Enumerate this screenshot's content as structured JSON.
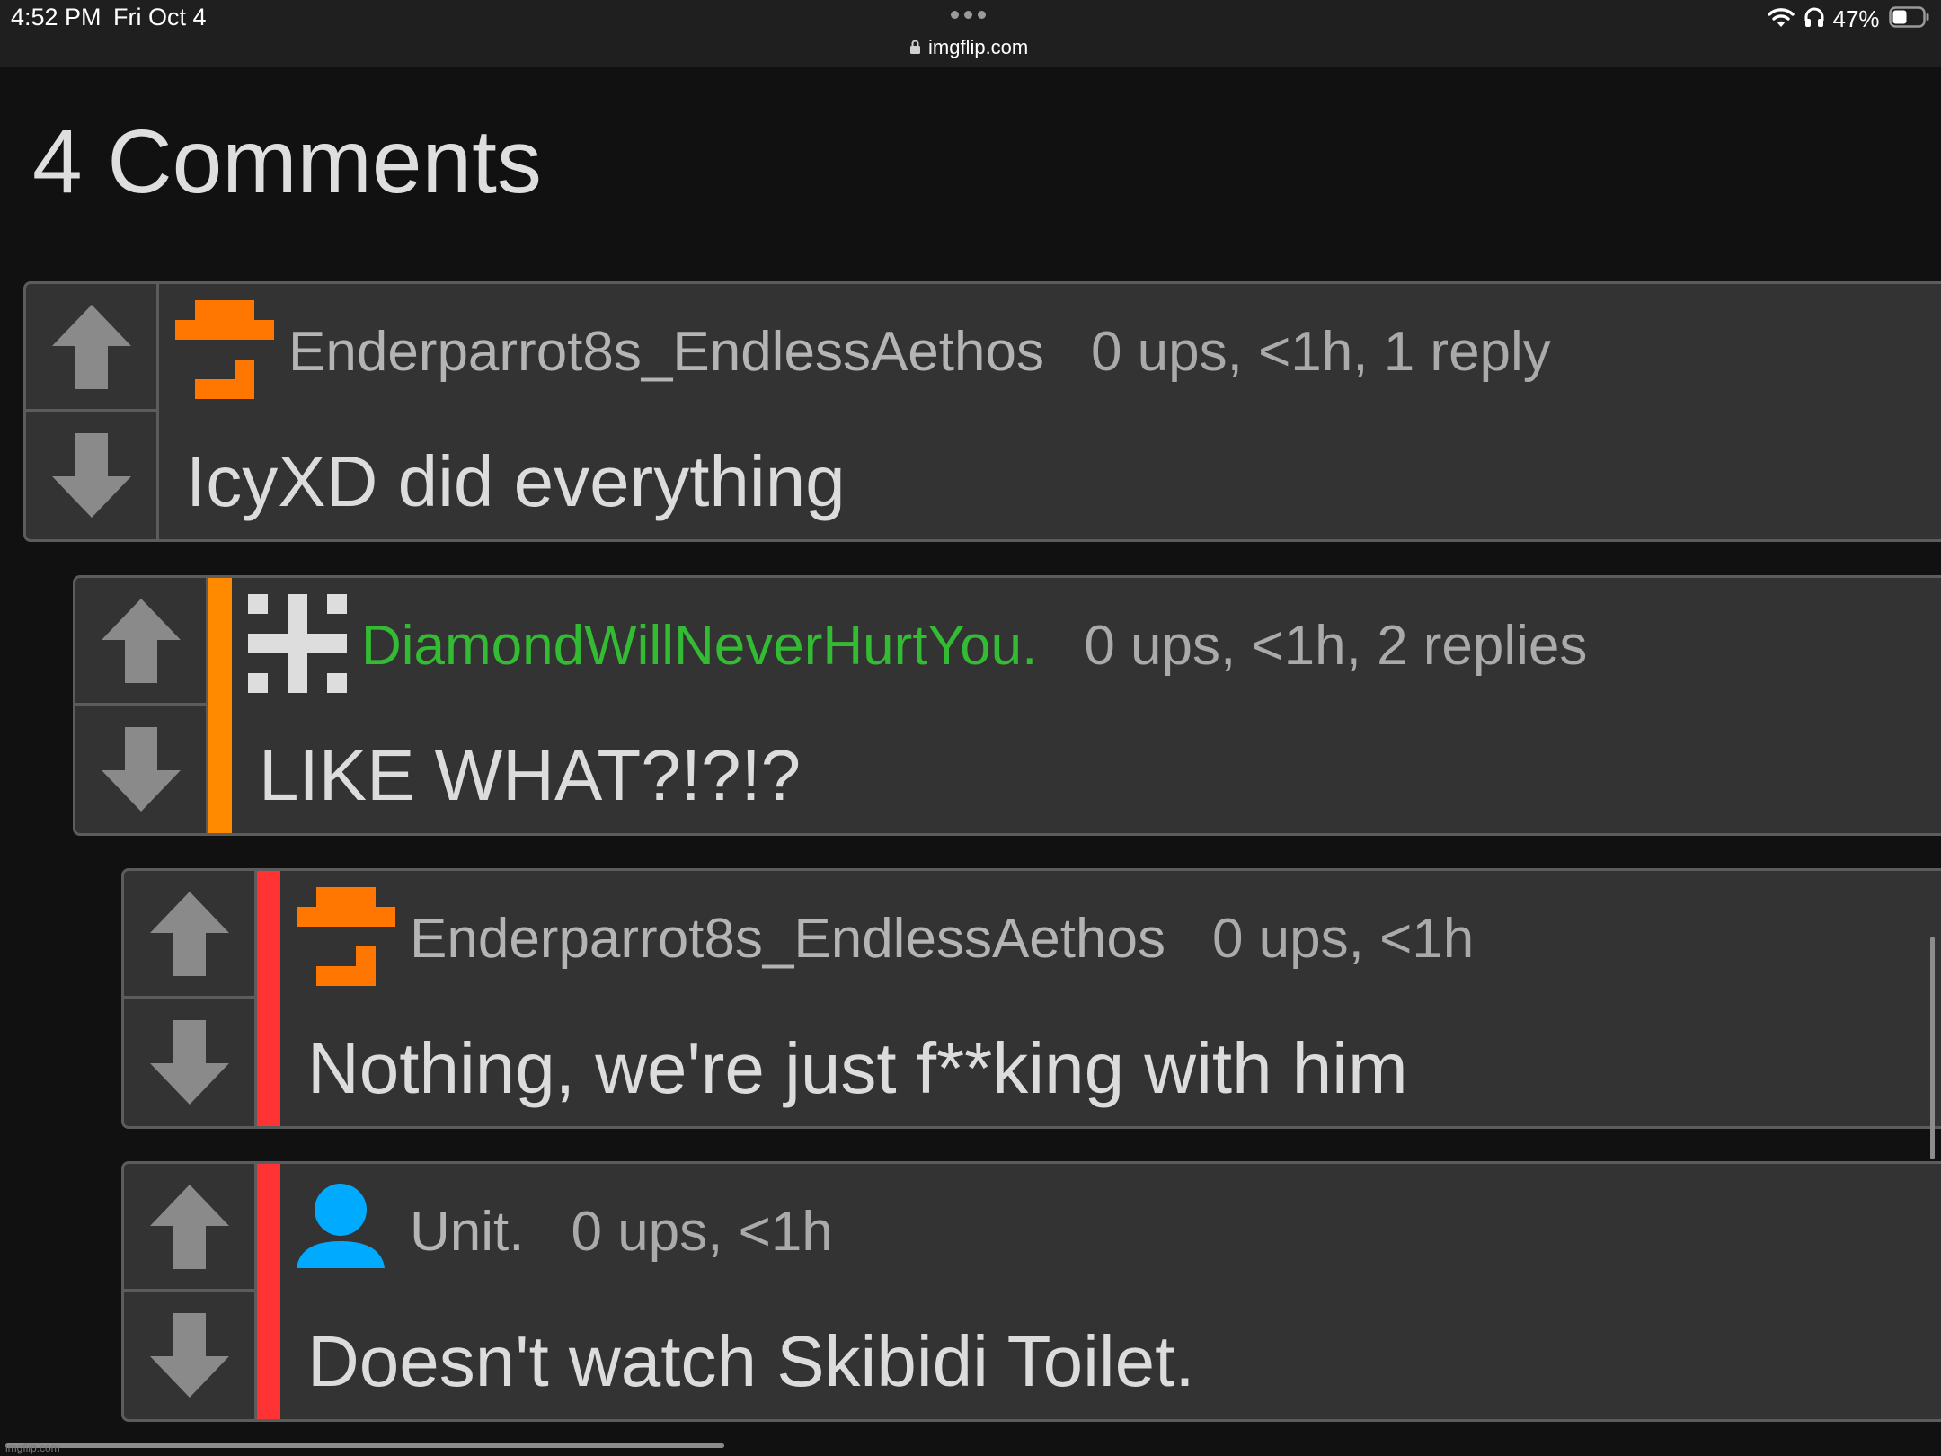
{
  "status_bar": {
    "time": "4:52 PM",
    "date": "Fri Oct 4",
    "battery_percent": "47%",
    "battery_level": 0.47,
    "icons": [
      "wifi-icon",
      "headphones-icon",
      "battery-icon"
    ]
  },
  "url_bar": {
    "domain": "imgflip.com",
    "icon": "lock-icon"
  },
  "header": {
    "title": "4 Comments"
  },
  "comments": [
    {
      "username": "Enderparrot8s_EndlessAethos",
      "stats": "0 ups, <1h, 1 reply",
      "text": "IcyXD did everything",
      "avatar": "pixel-avatar-orange",
      "username_color": "#b4b4b4",
      "thread_color": ""
    },
    {
      "username": "DiamondWillNeverHurtYou.",
      "stats": "0 ups, <1h, 2 replies",
      "text": "LIKE WHAT?!?!?",
      "avatar": "pixel-avatar-white",
      "username_color": "#33bb33",
      "thread_color": "#ff8a00"
    },
    {
      "username": "Enderparrot8s_EndlessAethos",
      "stats": "0 ups, <1h",
      "text": "Nothing, we're just f**king with him",
      "avatar": "pixel-avatar-orange",
      "username_color": "#b4b4b4",
      "thread_color": "#ff3333"
    },
    {
      "username": "Unit.",
      "stats": "0 ups, <1h",
      "text": "Doesn't watch Skibidi Toilet.",
      "avatar": "user-silhouette-icon",
      "username_color": "#b4b4b4",
      "thread_color": "#ff3333"
    }
  ],
  "watermark": "imgflip.com",
  "colors": {
    "background": "#111111",
    "card": "#333333",
    "card_border": "#5c5c5c",
    "vote_arrow": "#8a8a8a",
    "orange_accent": "#ff7700",
    "user_blue": "#00aaff"
  }
}
